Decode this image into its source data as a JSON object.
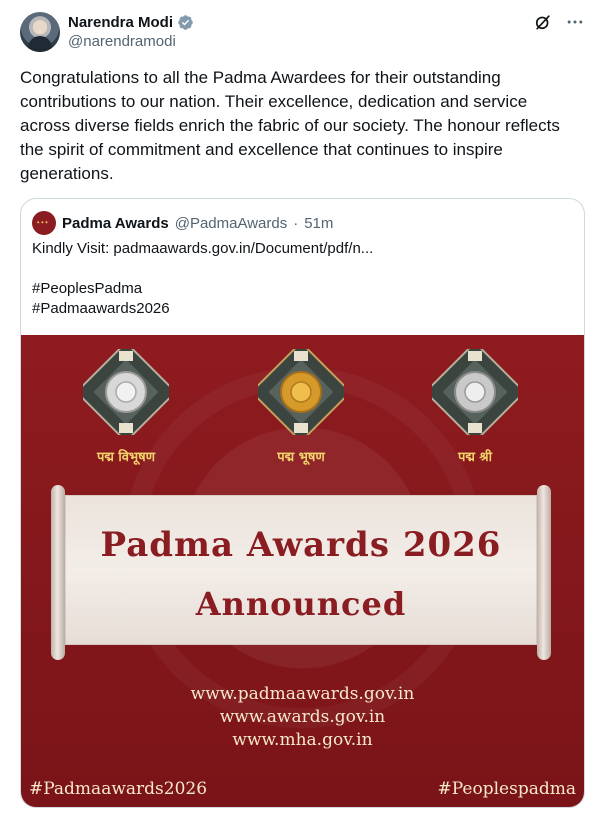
{
  "author": {
    "display_name": "Narendra Modi",
    "handle": "@narendramodi",
    "verified_icon": "verified-badge-icon",
    "verified_color": "#829aab"
  },
  "actions": {
    "grok_icon": "grok-icon",
    "more_icon": "more-options-icon"
  },
  "tweet": {
    "text": "Congratulations to all the Padma Awardees for their outstanding contributions to our nation. Their excellence, dedication and service across diverse fields enrich the fabric of our society. The honour reflects the spirit of commitment and excellence that continues to inspire generations."
  },
  "quote": {
    "name": "Padma Awards",
    "handle": "@PadmaAwards",
    "dot": "·",
    "time": "51m",
    "text": "Kindly Visit: padmaawards.gov.in/Document/pdf/n...\n\n#PeoplesPadma\n#Padmaawards2026"
  },
  "poster": {
    "bg_color": "#8e1b1f",
    "medals": [
      {
        "label": "पद्म विभूषण",
        "icon": "padma-vibhushan-medal-icon"
      },
      {
        "label": "पद्म भूषण",
        "icon": "padma-bhushan-medal-icon"
      },
      {
        "label": "पद्म श्री",
        "icon": "padma-shri-medal-icon"
      }
    ],
    "title_line1": "Padma Awards 2026",
    "title_line2": "Announced",
    "urls": [
      "www.padmaawards.gov.in",
      "www.awards.gov.in",
      "www.mha.gov.in"
    ],
    "hashtag_left": "#Padmaawards2026",
    "hashtag_right": "#Peoplespadma",
    "title_color": "#8a1d22",
    "text_color": "#f6e9c8"
  }
}
